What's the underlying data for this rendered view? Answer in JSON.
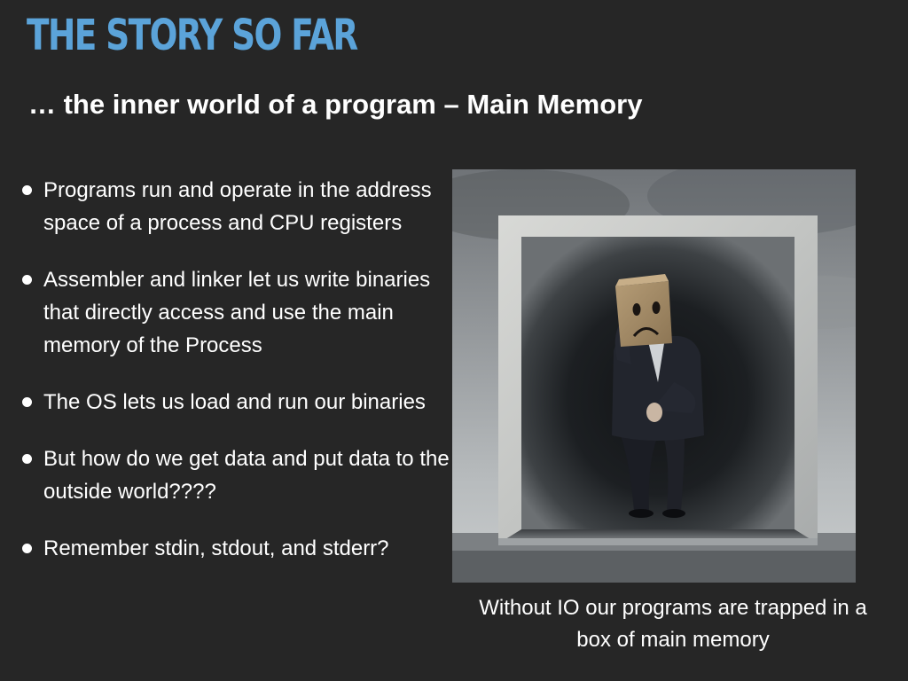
{
  "slide": {
    "title": "THE STORY SO FAR",
    "subtitle": "… the inner world of a program – Main Memory",
    "bullets": [
      "Programs run and operate in the address space of a process and CPU registers",
      "Assembler and linker let us write binaries that directly access and use the main memory of the Process",
      "The OS lets us load and run our binaries",
      "But how do we get data and put data to the outside world????",
      "Remember stdin, stdout, and stderr?"
    ],
    "caption": "Without IO our programs are trapped in a box of main memory"
  },
  "colors": {
    "background": "#262626",
    "title": "#5ba3d9",
    "text": "#ffffff"
  }
}
